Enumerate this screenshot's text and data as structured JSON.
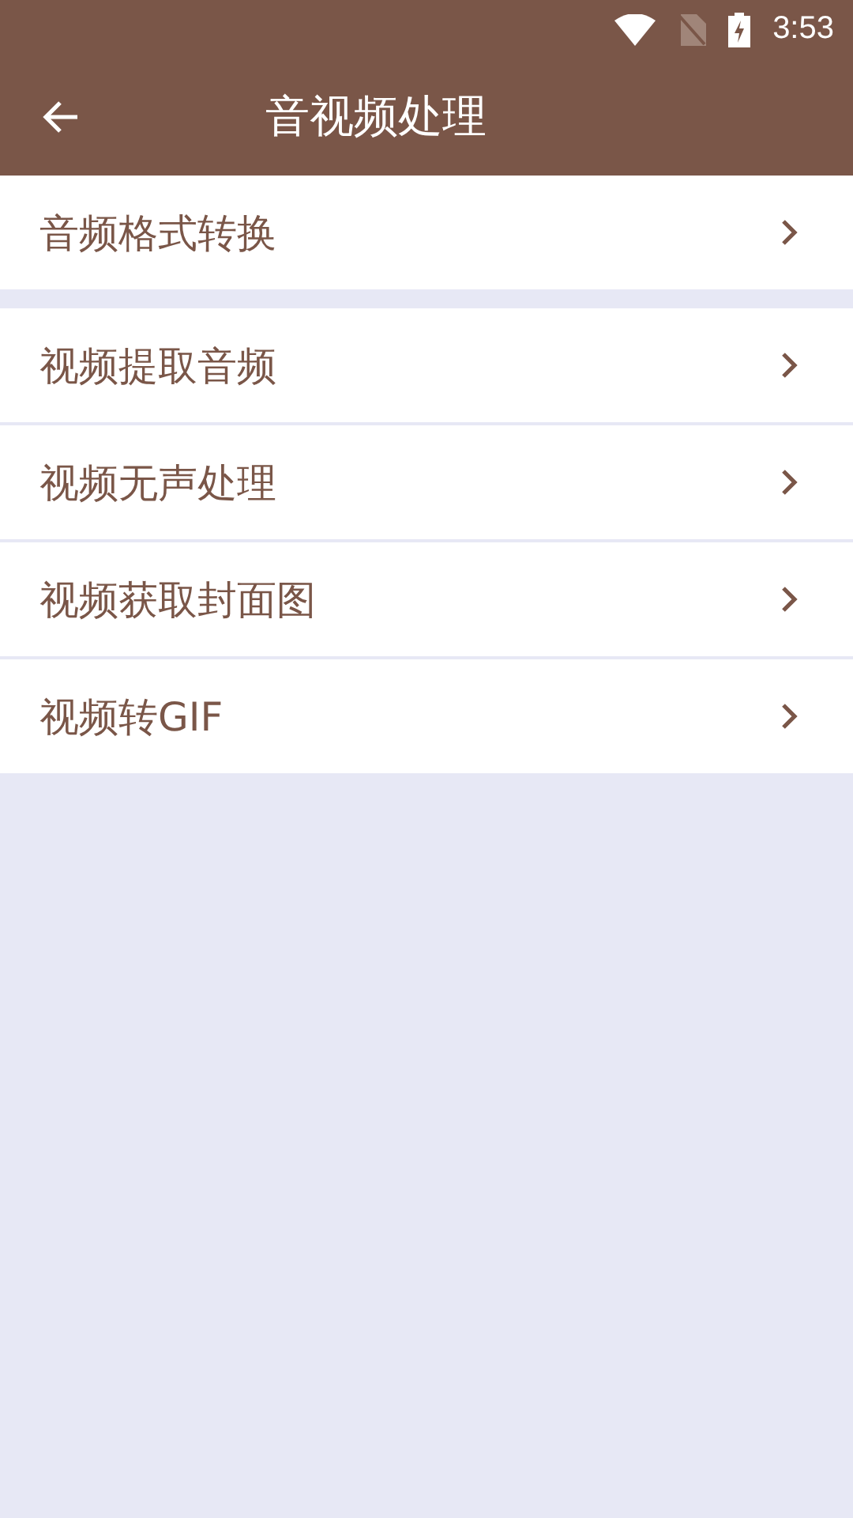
{
  "status_bar": {
    "time": "3:53"
  },
  "app_bar": {
    "title": "音视频处理"
  },
  "groups": [
    {
      "items": [
        {
          "label": "音频格式转换"
        }
      ]
    },
    {
      "items": [
        {
          "label": "视频提取音频"
        },
        {
          "label": "视频无声处理"
        },
        {
          "label": "视频获取封面图"
        },
        {
          "label": "视频转GIF"
        }
      ]
    }
  ]
}
